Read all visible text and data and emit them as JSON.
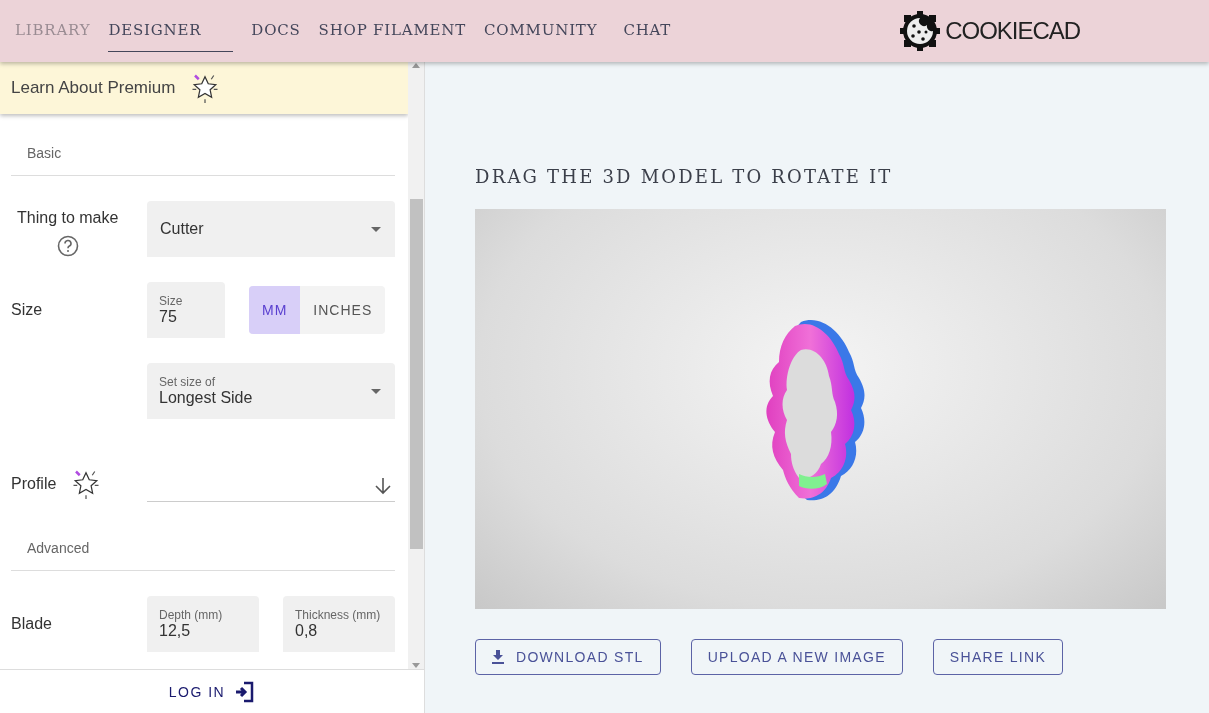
{
  "nav": {
    "tabs": [
      {
        "label": "LIBRARY",
        "selected": false,
        "disabled": true
      },
      {
        "label": "DESIGNER",
        "selected": true,
        "disabled": false
      },
      {
        "label": "DOCS",
        "selected": false,
        "disabled": false
      },
      {
        "label": "SHOP FILAMENT",
        "selected": false,
        "disabled": false
      },
      {
        "label": "COMMUNITY",
        "selected": false,
        "disabled": false
      },
      {
        "label": "CHAT",
        "selected": false,
        "disabled": false
      }
    ],
    "logo": "COOKIECAD"
  },
  "sidebar": {
    "premium": "Learn About Premium",
    "sections": [
      {
        "title": "Basic",
        "rows": [
          {
            "kind": "select",
            "label": "Thing to make",
            "help": true,
            "value": "Cutter"
          },
          {
            "kind": "size",
            "label": "Size",
            "field_label": "Size",
            "value": "75",
            "units": [
              {
                "label": "MM",
                "selected": true
              },
              {
                "label": "INCHES",
                "selected": false
              }
            ]
          },
          {
            "kind": "select",
            "field_label": "Set size of",
            "value": "Longest Side"
          },
          {
            "kind": "profile",
            "label": "Profile"
          }
        ]
      },
      {
        "title": "Advanced",
        "rows": [
          {
            "kind": "pair",
            "label": "Blade",
            "fields": [
              {
                "label": "Depth (mm)",
                "value": "12,5"
              },
              {
                "label": "Thickness (mm)",
                "value": "0,8"
              }
            ]
          }
        ]
      }
    ],
    "login": "LOG IN"
  },
  "viewer": {
    "heading": "DRAG THE 3D MODEL TO ROTATE IT",
    "buttons": [
      {
        "label": "DOWNLOAD STL",
        "icon": true
      },
      {
        "label": "UPLOAD A NEW IMAGE",
        "icon": false
      },
      {
        "label": "SHARE LINK",
        "icon": false
      }
    ]
  }
}
